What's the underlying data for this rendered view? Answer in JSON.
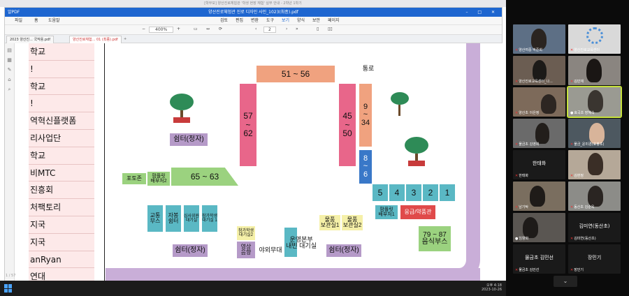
{
  "window_title": "[학부모] 양산진로체험관 '학생 현장 체험' 실무 안내 - 2학년 1학기",
  "app": {
    "name": "알PDF",
    "title": "양산진로체험관 진로 디자인 사인_1023(최종).pdf",
    "menu": [
      "파일",
      "홈",
      "도움말"
    ],
    "ribbon": [
      "검토",
      "편집",
      "변환",
      "도구",
      "보기",
      "양식",
      "보안",
      "페이지"
    ],
    "zoom": "400%",
    "page": "2",
    "tabs": [
      "2023 양산진... 국작용.pdf",
      "양산진로체험... 01 (최종).pdf"
    ]
  },
  "doc": {
    "rows": [
      "학교",
      "!",
      "학교",
      "!",
      "역혁신플랫폼",
      "리사업단",
      "학교",
      "비MTC",
      "진흥회",
      "처팩토리",
      "지국",
      "지국",
      "anRyan",
      "연대"
    ],
    "map": {
      "label_51_56": "51 ~ 56",
      "label_tongro": "통로",
      "label_57_62": "57\n~\n62",
      "label_45_50": "45\n~\n50",
      "label_9_34": "9\n~\n34",
      "label_8_6": "8\n~\n6",
      "shelter1": "쉼터(정자)",
      "photozone": "포토존",
      "platform2": "팜플릿\n배부처2",
      "label_65_63": "65 ~ 63",
      "num1": "1",
      "num2": "2",
      "num3": "3",
      "num4": "4",
      "num5": "5",
      "platform1": "팜플릿\n배부처1",
      "emergency": "응급/약품관",
      "transport": "교통\n부스",
      "selfshelter": "자봉\n쉼터",
      "judges": "심사위원\n대기실",
      "participants1": "참가학생\n대기실 1",
      "participants2": "참가학생\n대기실2",
      "video": "영상\n음향",
      "stage": "야외무대",
      "ops": "운영본부\n내빈 대기실",
      "storage1": "물품\n보관실1",
      "storage2": "물품\n보관실2",
      "shelter2": "쉼터(정자)",
      "shelter3": "쉼터(정자)",
      "shelter4": "쉼터(정자)",
      "food": "79 ~ 87\n음식부스"
    }
  },
  "status_page": "1 / 57",
  "clock": {
    "time": "오후 4:18",
    "date": "2023-10-26"
  },
  "participants": [
    {
      "name": "양산여중 박준희",
      "mic_muted": true
    },
    {
      "name": "양산진로교육센터",
      "mic_muted": true
    },
    {
      "name": "양산진로교육센터_나...",
      "mic_muted": true
    },
    {
      "name": "김민재",
      "mic_muted": true
    },
    {
      "name": "양산초 이은정",
      "mic_muted": true
    },
    {
      "name": "효곡초 장혜숙",
      "mic_muted": false
    },
    {
      "name": "물금초 김영희",
      "mic_muted": true
    },
    {
      "name": "물금_윤미경(효봉초)",
      "mic_muted": true
    },
    {
      "name": "한태화",
      "mic_muted": true
    },
    {
      "name": "김현정",
      "mic_muted": true
    },
    {
      "name": "남기탁",
      "mic_muted": true
    },
    {
      "name": "동산초 김순옥",
      "mic_muted": true
    },
    {
      "name": "임향화",
      "mic_muted": false
    },
    {
      "name": "김미연(동산초)",
      "mic_muted": true
    },
    {
      "name": "물금초 김민선",
      "mic_muted": true
    },
    {
      "name": "장민기",
      "mic_muted": true
    }
  ],
  "tile_labels": {
    "hantaehwa": "한태화",
    "kimmiyeon": "김미연(동산초)",
    "kimminseon": "물금초 김민선",
    "jangmingi": "장민기"
  },
  "more_icon": "chevron-down-icon",
  "colors": {
    "accent": "#1e66d0",
    "plum": "#b59ac8",
    "pink": "#e8668a"
  }
}
